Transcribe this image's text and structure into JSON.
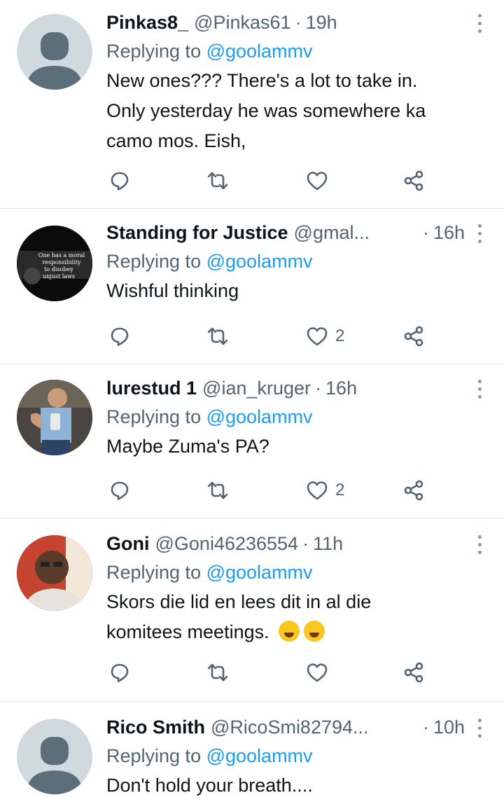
{
  "tweets": [
    {
      "name": "Pinkas8_",
      "handle": "@Pinkas61",
      "sep": "·",
      "time": "19h",
      "replying_prefix": "Replying to ",
      "replying_handle": "@goolammv",
      "lines": [
        "New ones??? There's a lot to take in.",
        "Only yesterday he was somewhere ka",
        "camo mos. Eish,"
      ],
      "likes": ""
    },
    {
      "name": "Standing for Justice",
      "handle": "@gmal...",
      "sep": "·",
      "time": "16h",
      "replying_prefix": "Replying to ",
      "replying_handle": "@goolammv",
      "lines": [
        "Wishful thinking"
      ],
      "likes": "2",
      "avatar_text": [
        "One has a moral",
        "responsibility",
        "to disobey",
        "unjust laws"
      ]
    },
    {
      "name": "lurestud 1",
      "handle": "@ian_kruger",
      "sep": "·",
      "time": "16h",
      "replying_prefix": "Replying to ",
      "replying_handle": "@goolammv",
      "lines": [
        "Maybe Zuma's PA?"
      ],
      "likes": "2"
    },
    {
      "name": "Goni",
      "handle": "@Goni46236554",
      "sep": "·",
      "time": "11h",
      "replying_prefix": "Replying to ",
      "replying_handle": "@goolammv",
      "lines": [
        "Skors die lid en lees dit in al die",
        "komitees meetings."
      ],
      "likes": "",
      "emoji": [
        "rolling-on-floor-laughing",
        "face-with-tears-of-joy"
      ]
    },
    {
      "name": "Rico Smith",
      "handle": "@RicoSmi82794...",
      "sep": "·",
      "time": "10h",
      "replying_prefix": "Replying to ",
      "replying_handle": "@goolammv",
      "lines": [
        "Don't hold your breath...."
      ],
      "likes": ""
    }
  ],
  "icons": {
    "reply": "reply-icon",
    "retweet": "retweet-icon",
    "like": "heart-icon",
    "share": "share-icon",
    "more": "more-options-icon"
  },
  "colors": {
    "link": "#1d9bf0",
    "secondary": "#536471",
    "text": "#0f1419",
    "divider": "#e1e8ed"
  }
}
